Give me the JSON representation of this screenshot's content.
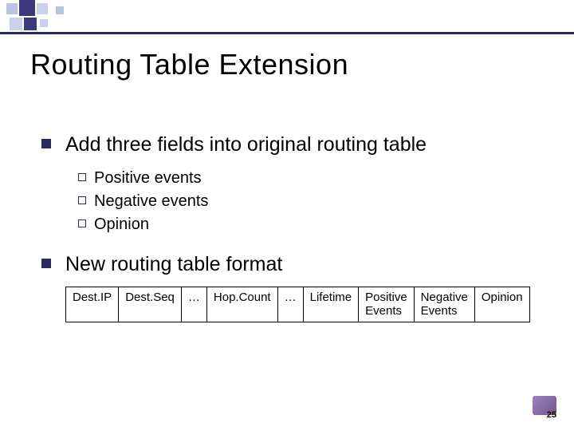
{
  "title": "Routing Table Extension",
  "bullets": [
    {
      "text": "Add three fields into original routing table",
      "sub": [
        "Positive events",
        "Negative events",
        "Opinion"
      ]
    },
    {
      "text": "New routing table format",
      "sub": []
    }
  ],
  "table": {
    "cells": [
      "Dest.IP",
      "Dest.Seq",
      "…",
      "Hop.Count",
      "…",
      "Lifetime",
      "Positive Events",
      "Negative Events",
      "Opinion"
    ]
  },
  "page_number": "25"
}
